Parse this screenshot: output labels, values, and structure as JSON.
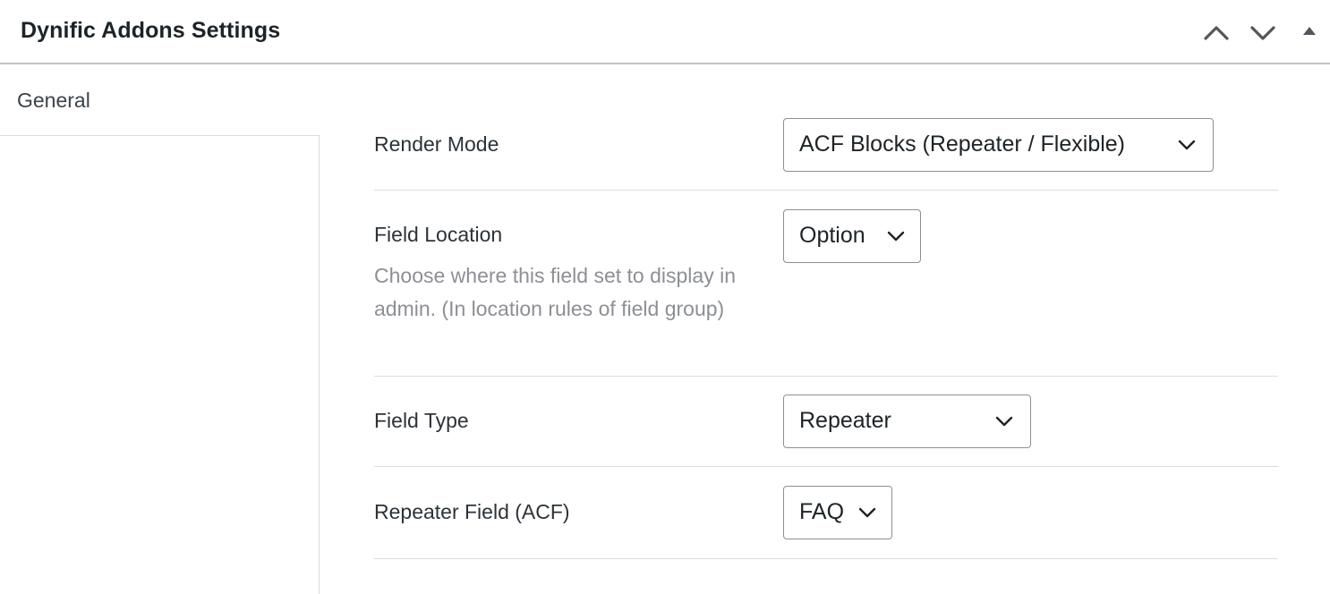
{
  "panel": {
    "title": "Dynific Addons Settings",
    "controls": {
      "move_up_icon": "chevron-up-icon",
      "move_down_icon": "chevron-down-icon",
      "toggle_icon": "triangle-up-icon"
    }
  },
  "sidebar": {
    "tabs": [
      {
        "label": "General",
        "active": true
      }
    ]
  },
  "settings": {
    "rows": [
      {
        "label": "Render Mode",
        "description": "",
        "value": "ACF Blocks (Repeater / Flexible)"
      },
      {
        "label": "Field Location",
        "description": "Choose where this field set to display in admin. (In location rules of field group)",
        "value": "Option"
      },
      {
        "label": "Field Type",
        "description": "",
        "value": "Repeater"
      },
      {
        "label": "Repeater Field (ACF)",
        "description": "",
        "value": "FAQ"
      }
    ]
  },
  "colors": {
    "text": "#1d2327",
    "muted": "#8c8f94",
    "border": "#dcdcde",
    "header_border": "#c3c4c7"
  }
}
